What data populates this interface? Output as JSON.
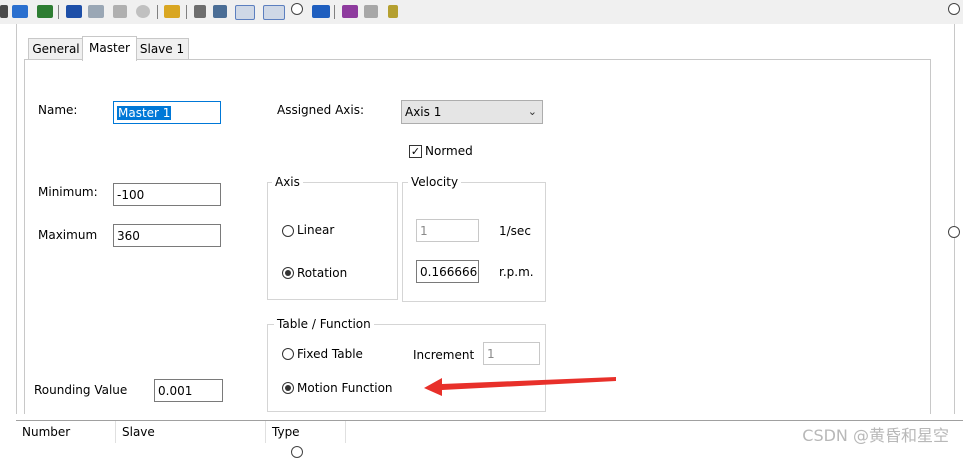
{
  "tabs": [
    {
      "label": "General"
    },
    {
      "label": "Master"
    },
    {
      "label": "Slave 1"
    }
  ],
  "master": {
    "name_label": "Name:",
    "name_value": "Master 1",
    "minimum_label": "Minimum:",
    "minimum_value": "-100",
    "maximum_label": "Maximum",
    "maximum_value": "360",
    "rounding_label": "Rounding Value",
    "rounding_value": "0.001",
    "assigned_axis_label": "Assigned Axis:",
    "assigned_axis_value": "Axis 1",
    "normed_label": "Normed",
    "normed_checked": true,
    "axis_group": {
      "title": "Axis",
      "linear_label": "Linear",
      "rotation_label": "Rotation",
      "selected": "Rotation"
    },
    "velocity_group": {
      "title": "Velocity",
      "value1": "1",
      "unit1": "1/sec",
      "value2": "0.1666666",
      "unit2": "r.p.m."
    },
    "table_group": {
      "title": "Table / Function",
      "fixed_label": "Fixed Table",
      "motion_label": "Motion Function",
      "selected": "Motion Function",
      "increment_label": "Increment",
      "increment_value": "1"
    }
  },
  "grid": {
    "columns": [
      "Number",
      "Slave",
      "Type"
    ]
  },
  "watermark": "CSDN @黄昏和星空",
  "colors": {
    "selection": "#0078d7",
    "annotation_arrow": "#e8302a"
  },
  "icons": [
    "toolbar-icon"
  ]
}
